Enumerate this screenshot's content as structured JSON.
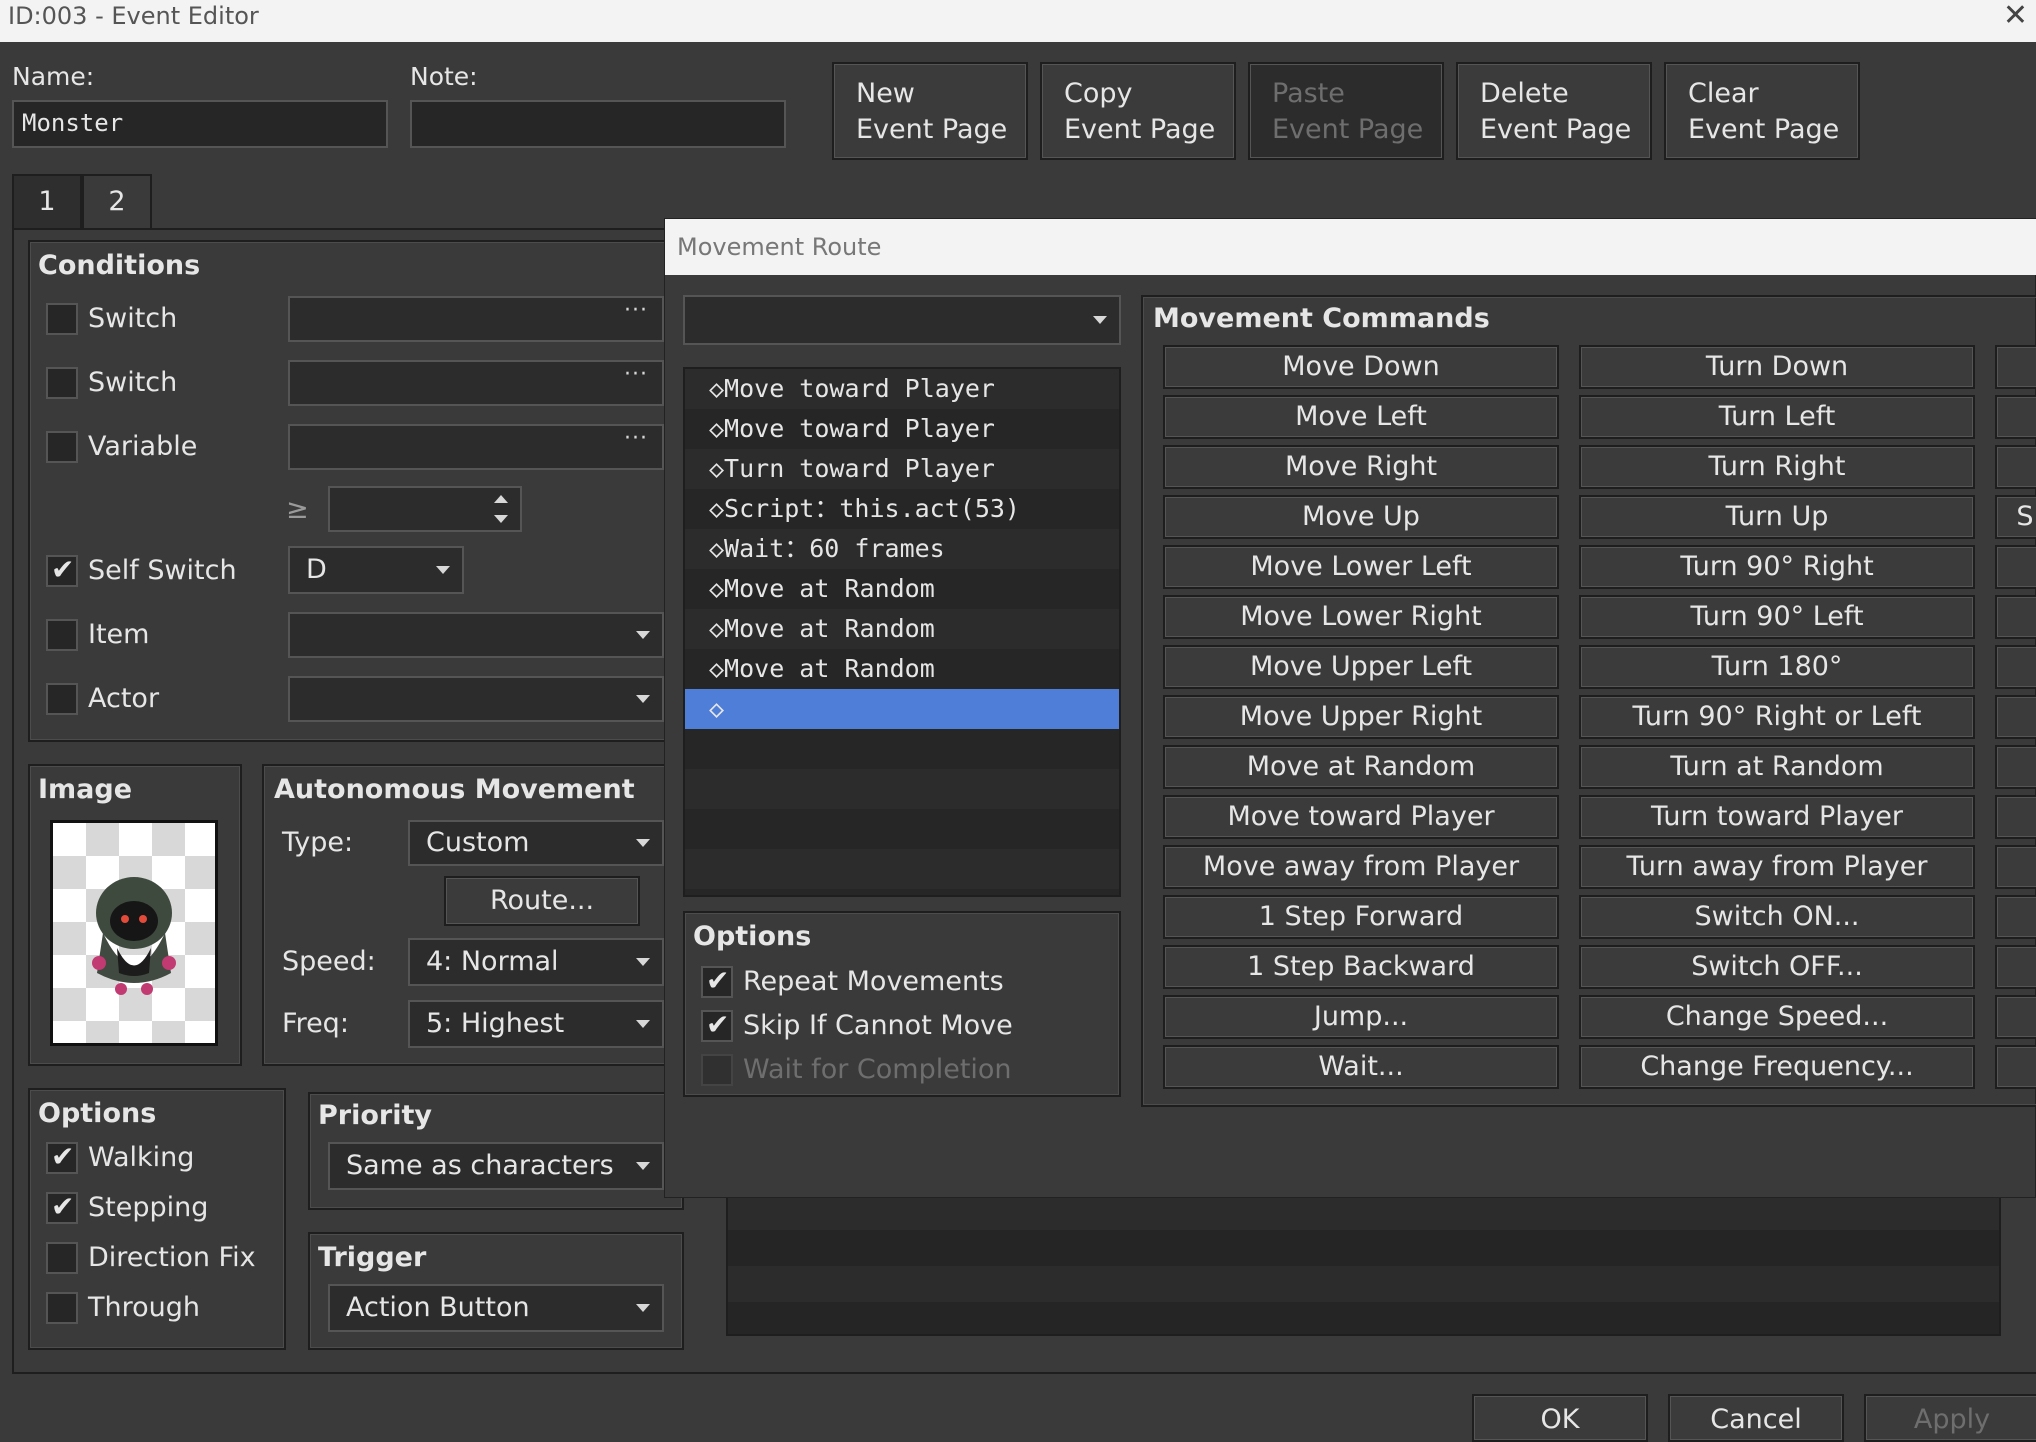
{
  "window": {
    "title": "ID:003 - Event Editor",
    "close": "✕"
  },
  "header": {
    "name_label": "Name:",
    "name_value": "Monster",
    "note_label": "Note:",
    "note_value": "",
    "buttons": [
      "New\nEvent Page",
      "Copy\nEvent Page",
      "Paste\nEvent Page",
      "Delete\nEvent Page",
      "Clear\nEvent Page"
    ]
  },
  "tabs": [
    "1",
    "2"
  ],
  "conditions": {
    "title": "Conditions",
    "rows": [
      {
        "label": "Switch",
        "checked": false,
        "value": ""
      },
      {
        "label": "Switch",
        "checked": false,
        "value": ""
      },
      {
        "label": "Variable",
        "checked": false,
        "value": ""
      },
      {
        "label": "Self Switch",
        "checked": true,
        "value": "D"
      },
      {
        "label": "Item",
        "checked": false,
        "value": ""
      },
      {
        "label": "Actor",
        "checked": false,
        "value": ""
      }
    ],
    "geq": "≥",
    "dots": "···"
  },
  "image": {
    "title": "Image",
    "sprite": "hooded-monster"
  },
  "autonomous": {
    "title": "Autonomous Movement",
    "type_label": "Type:",
    "type_value": "Custom",
    "route_button": "Route...",
    "speed_label": "Speed:",
    "speed_value": "4: Normal",
    "freq_label": "Freq:",
    "freq_value": "5: Highest"
  },
  "options": {
    "title": "Options",
    "items": [
      {
        "label": "Walking",
        "checked": true
      },
      {
        "label": "Stepping",
        "checked": true
      },
      {
        "label": "Direction Fix",
        "checked": false
      },
      {
        "label": "Through",
        "checked": false
      }
    ]
  },
  "priority": {
    "title": "Priority",
    "value": "Same as characters"
  },
  "trigger": {
    "title": "Trigger",
    "value": "Action Button"
  },
  "footer": {
    "ok": "OK",
    "cancel": "Cancel",
    "apply": "Apply"
  },
  "movement_route": {
    "title": "Movement Route",
    "target": "",
    "list": [
      "◇Move toward Player",
      "◇Move toward Player",
      "◇Turn toward Player",
      "◇Script：this.act(53)",
      "◇Wait：60 frames",
      "◇Move at Random",
      "◇Move at Random",
      "◇Move at Random",
      "◇",
      "",
      "",
      "",
      ""
    ],
    "selected_index": 8,
    "options": {
      "title": "Options",
      "items": [
        {
          "label": "Repeat Movements",
          "checked": true,
          "enabled": true
        },
        {
          "label": "Skip If Cannot Move",
          "checked": true,
          "enabled": true
        },
        {
          "label": "Wait for Completion",
          "checked": false,
          "enabled": false
        }
      ]
    },
    "commands_title": "Movement Commands",
    "col1": [
      "Move Down",
      "Move Left",
      "Move Right",
      "Move Up",
      "Move Lower Left",
      "Move Lower Right",
      "Move Upper Left",
      "Move Upper Right",
      "Move at Random",
      "Move toward Player",
      "Move away from Player",
      "1 Step Forward",
      "1 Step Backward",
      "Jump...",
      "Wait..."
    ],
    "col2": [
      "Turn Down",
      "Turn Left",
      "Turn Right",
      "Turn Up",
      "Turn 90° Right",
      "Turn 90° Left",
      "Turn 180°",
      "Turn 90° Right or Left",
      "Turn at Random",
      "Turn toward Player",
      "Turn away from Player",
      "Switch ON...",
      "Switch OFF...",
      "Change Speed...",
      "Change Frequency..."
    ],
    "col3": [
      "",
      "",
      "",
      "S",
      "",
      "",
      "",
      "",
      "",
      "",
      "",
      "",
      "",
      "",
      ""
    ]
  },
  "colors": {
    "selection": "#4f7ed8",
    "background": "#3a3a3a",
    "field": "#262626"
  }
}
